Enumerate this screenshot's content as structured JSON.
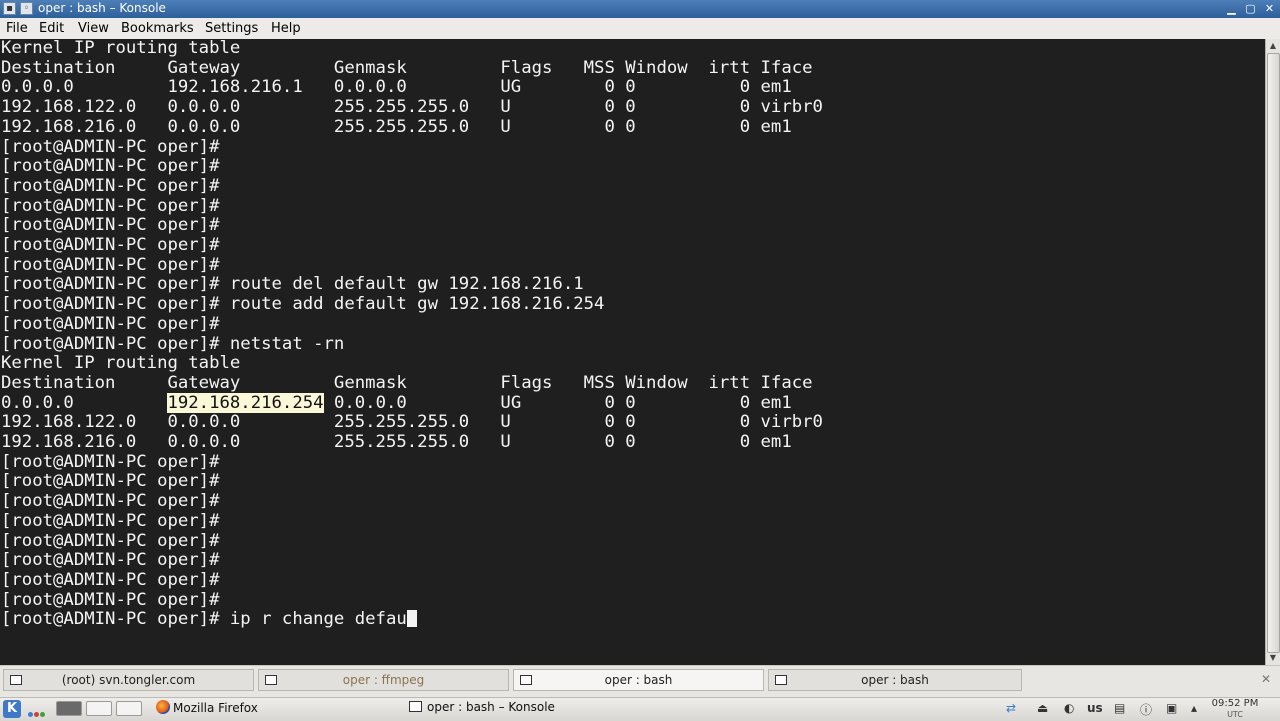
{
  "window": {
    "title": "oper : bash – Konsole"
  },
  "menu": [
    {
      "label": "File"
    },
    {
      "label": "Edit"
    },
    {
      "label": "View"
    },
    {
      "label": "Bookmarks"
    },
    {
      "label": "Settings"
    },
    {
      "label": "Help"
    }
  ],
  "terminal": {
    "block1": "Kernel IP routing table\nDestination     Gateway         Genmask         Flags   MSS Window  irtt Iface\n0.0.0.0         192.168.216.1   0.0.0.0         UG        0 0          0 em1\n192.168.122.0   0.0.0.0         255.255.255.0   U         0 0          0 virbr0\n192.168.216.0   0.0.0.0         255.255.255.0   U         0 0          0 em1\n[root@ADMIN-PC oper]#\n[root@ADMIN-PC oper]#\n[root@ADMIN-PC oper]#\n[root@ADMIN-PC oper]#\n[root@ADMIN-PC oper]#\n[root@ADMIN-PC oper]#\n[root@ADMIN-PC oper]#\n[root@ADMIN-PC oper]# route del default gw 192.168.216.1\n[root@ADMIN-PC oper]# route add default gw 192.168.216.254\n[root@ADMIN-PC oper]#\n[root@ADMIN-PC oper]# netstat -rn\nKernel IP routing table\nDestination     Gateway         Genmask         Flags   MSS Window  irtt Iface\n0.0.0.0         ",
    "highlight": "192.168.216.254",
    "block2": " 0.0.0.0         UG        0 0          0 em1\n192.168.122.0   0.0.0.0         255.255.255.0   U         0 0          0 virbr0\n192.168.216.0   0.0.0.0         255.255.255.0   U         0 0          0 em1\n[root@ADMIN-PC oper]#\n[root@ADMIN-PC oper]#\n[root@ADMIN-PC oper]#\n[root@ADMIN-PC oper]#\n[root@ADMIN-PC oper]#\n[root@ADMIN-PC oper]#\n[root@ADMIN-PC oper]#\n[root@ADMIN-PC oper]#\n[root@ADMIN-PC oper]# ip r change defau"
  },
  "tabs": [
    {
      "label": "(root) svn.tongler.com"
    },
    {
      "label": "oper : ffmpeg"
    },
    {
      "label": "oper : bash"
    },
    {
      "label": "oper : bash"
    }
  ],
  "taskbar": {
    "tasks": [
      {
        "label": "Mozilla Firefox"
      },
      {
        "label": "oper : bash – Konsole"
      }
    ],
    "keyboard_layout": "us",
    "clock_time": "09:52 PM",
    "clock_zone": "UTC"
  },
  "colors": {
    "terminal_bg": "#1f1f1f",
    "terminal_fg": "#f4f4f4",
    "selection_bg": "#fbf8d8",
    "titlebar": "#3a6ba8"
  }
}
